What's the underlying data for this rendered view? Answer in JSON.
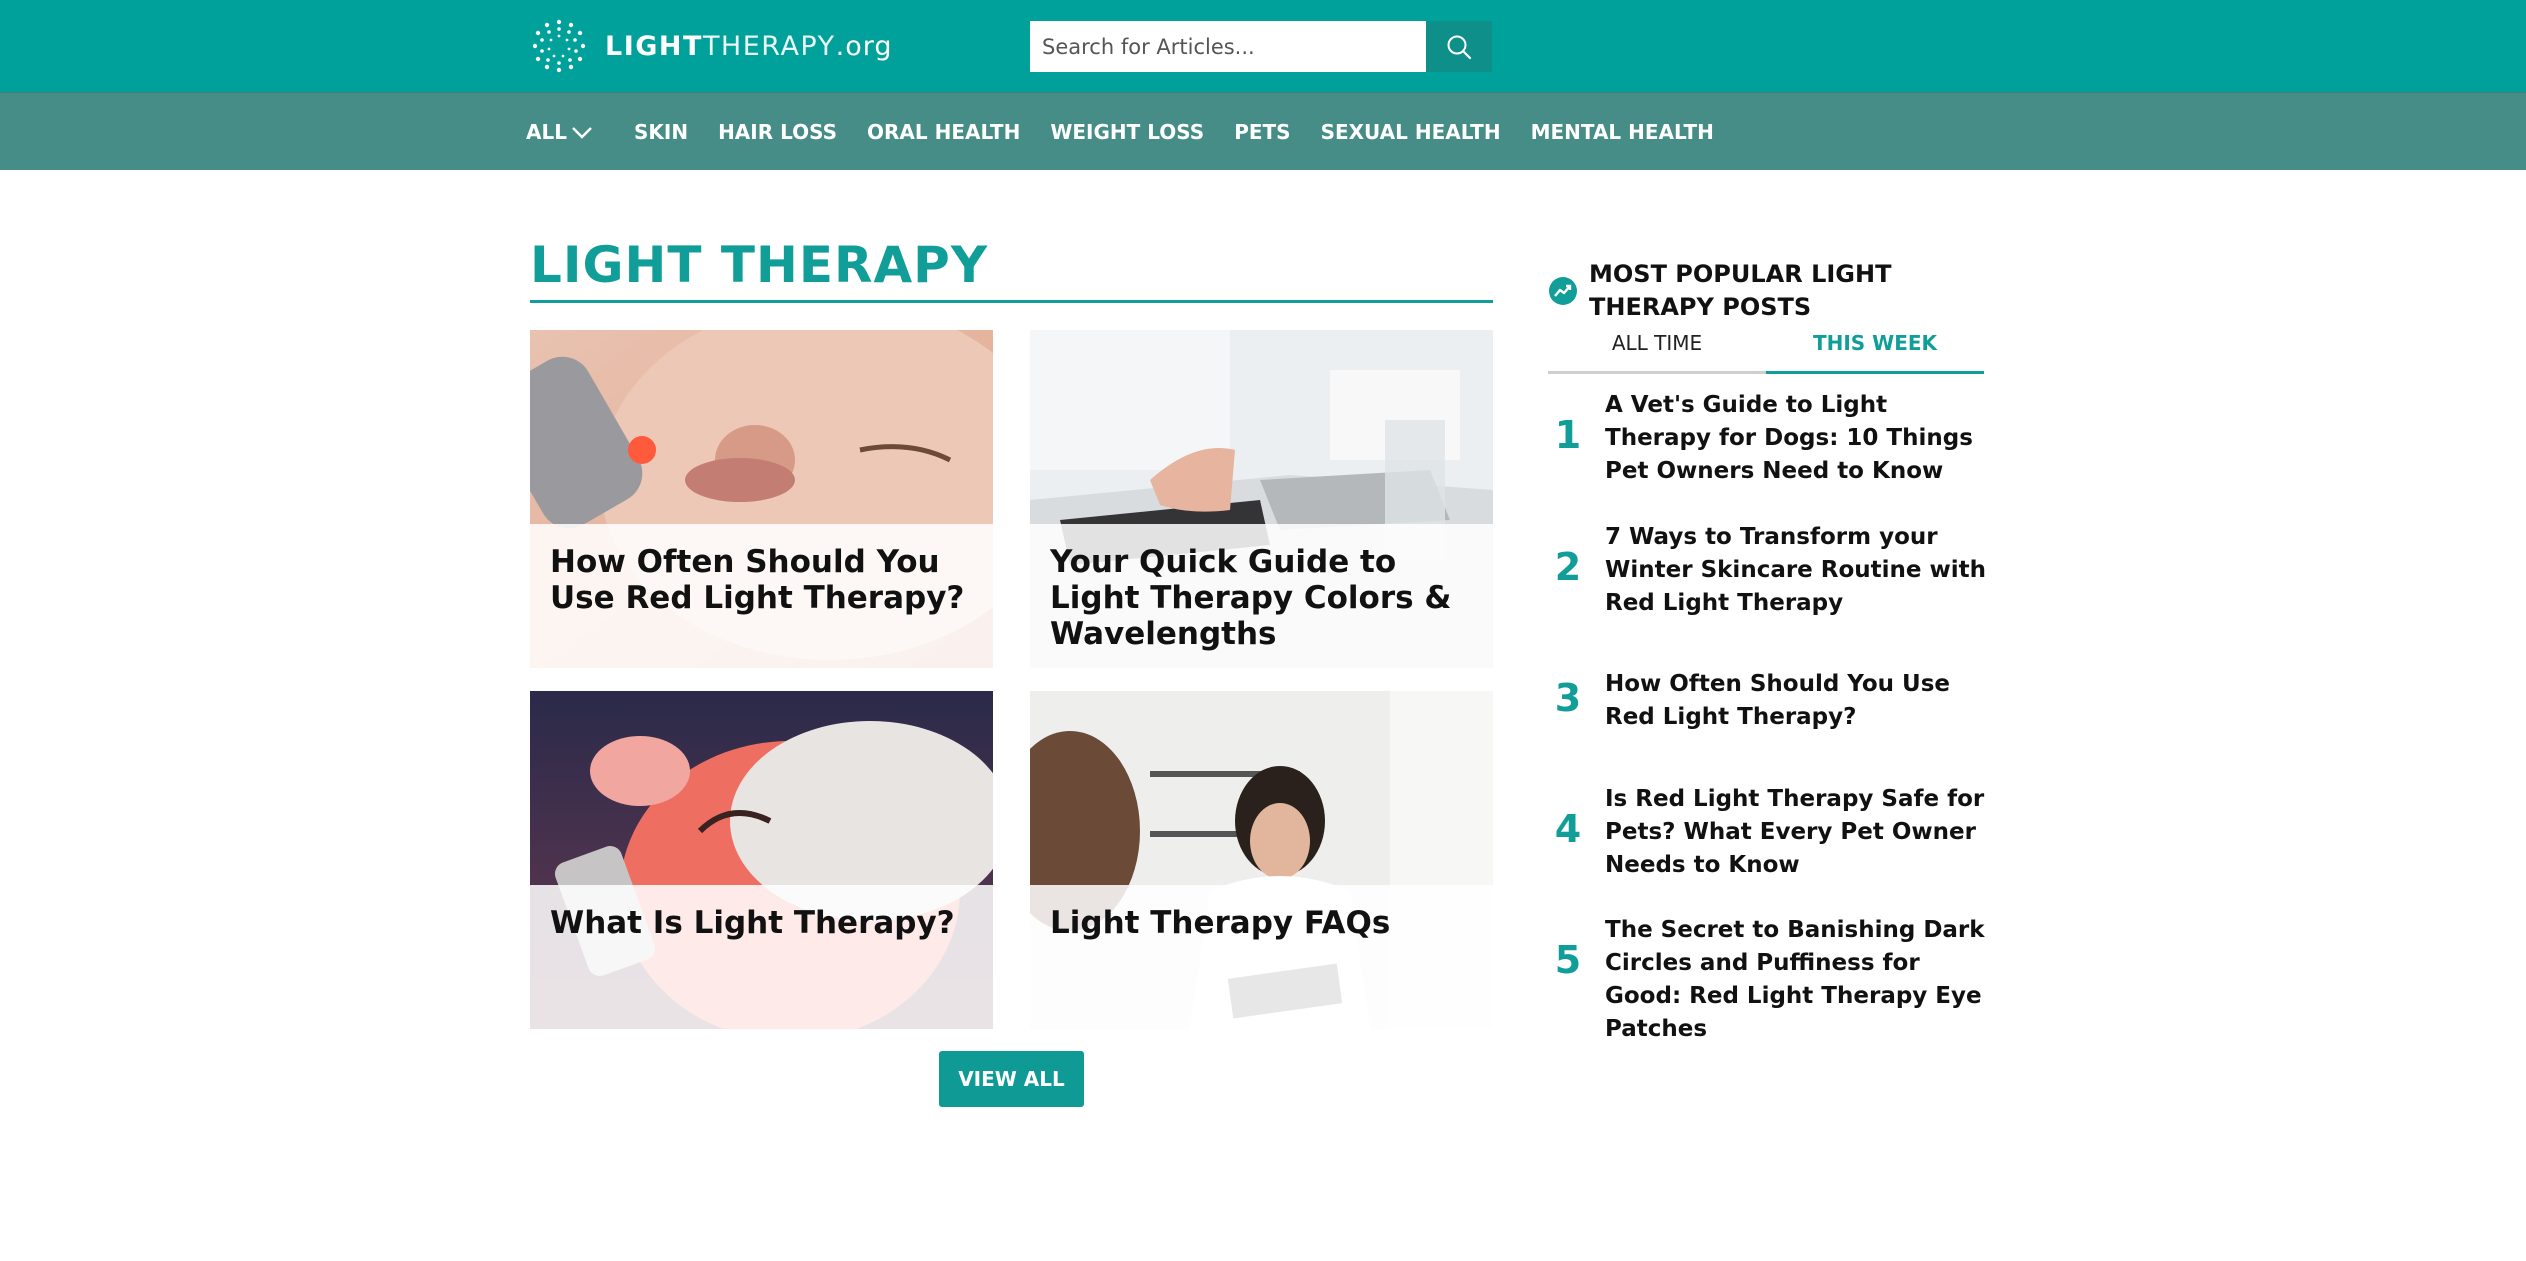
{
  "header": {
    "logo_bold": "LIGHT",
    "logo_light": "THERAPY",
    "logo_suffix": ".org",
    "search_placeholder": "Search for Articles..."
  },
  "nav": {
    "all_label": "ALL",
    "items": [
      "SKIN",
      "HAIR LOSS",
      "ORAL HEALTH",
      "WEIGHT LOSS",
      "PETS",
      "SEXUAL HEALTH",
      "MENTAL HEALTH"
    ]
  },
  "main": {
    "section_title": "LIGHT THERAPY",
    "cards": [
      {
        "title": "How Often Should You Use Red Light Therapy?"
      },
      {
        "title": "Your Quick Guide to Light Therapy Colors & Wavelengths"
      },
      {
        "title": "What Is Light Therapy?"
      },
      {
        "title": "Light Therapy FAQs"
      }
    ],
    "view_all_label": "VIEW ALL"
  },
  "sidebar": {
    "heading": "MOST POPULAR LIGHT THERAPY POSTS",
    "tabs": [
      {
        "label": "ALL TIME",
        "active": false
      },
      {
        "label": "THIS WEEK",
        "active": true
      }
    ],
    "posts": [
      {
        "rank": "1",
        "title": "A Vet's Guide to Light Therapy for Dogs: 10 Things Pet Owners Need to Know"
      },
      {
        "rank": "2",
        "title": "7 Ways to Transform your Winter Skincare Routine with Red Light Therapy"
      },
      {
        "rank": "3",
        "title": "How Often Should You Use Red Light Therapy?"
      },
      {
        "rank": "4",
        "title": "Is Red Light Therapy Safe for Pets? What Every Pet Owner Needs to Know"
      },
      {
        "rank": "5",
        "title": "The Secret to Banishing Dark Circles and Puffiness for Good: Red Light Therapy Eye Patches"
      }
    ]
  },
  "colors": {
    "header_teal": "#00A19B",
    "nav_teal": "#458D86",
    "accent": "#119E99"
  }
}
